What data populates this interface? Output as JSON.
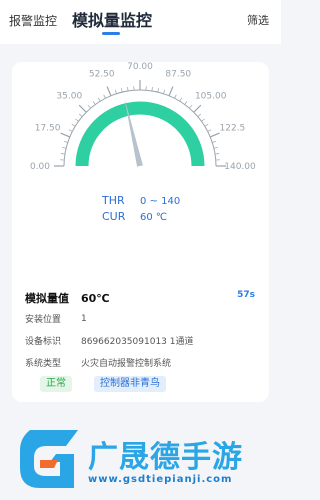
{
  "header": {
    "tab_alarm": "报警监控",
    "tab_analog": "模拟量监控",
    "filter_label": "筛选"
  },
  "gauge": {
    "min": 0,
    "max": 140,
    "value": 60,
    "tick_labels": [
      "0.00",
      "17.50",
      "35.00",
      "52.50",
      "70.00",
      "87.50",
      "105.00",
      "122.5",
      "140.00"
    ],
    "thr_label": "THR",
    "thr_value": "0 ~ 140",
    "cur_label": "CUR",
    "cur_value": "60 ℃",
    "colors": {
      "arc": "#2ecfa0",
      "needle": "#b8c2cc",
      "text": "#2b6fd6"
    }
  },
  "details": {
    "analog_label": "模拟量值",
    "analog_value": "60℃",
    "age": "57s",
    "location_label": "安装位置",
    "location_value": "1",
    "device_label": "设备标识",
    "device_value": "869662035091013 1通道",
    "system_label": "系统类型",
    "system_value": "火灾自动报警控制系统"
  },
  "tags": {
    "status": "正常",
    "controller": "控制器非青鸟"
  },
  "watermark": {
    "title": "广晟德手游",
    "url": "www.gsdtiepianji.com"
  }
}
